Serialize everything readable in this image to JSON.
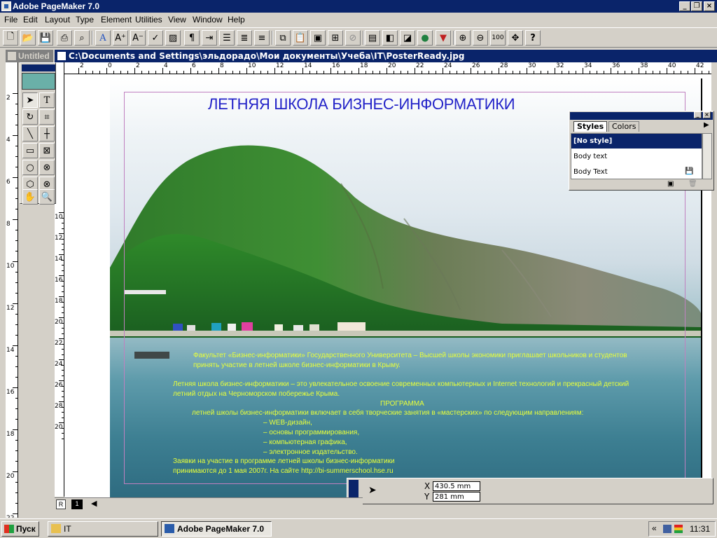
{
  "app": {
    "title": "Adobe PageMaker 7.0"
  },
  "menu": [
    "File",
    "Edit",
    "Layout",
    "Type",
    "Element",
    "Utilities",
    "View",
    "Window",
    "Help"
  ],
  "untitled_tab": "Untitled",
  "document": {
    "path": "C:\\Documents and Settings\\эльдорадо\\Мои документы\\Учеба\\IT\\PosterReady.jpg"
  },
  "hruler_labels": [
    "2",
    "0",
    "2",
    "4",
    "6",
    "8",
    "10",
    "12",
    "14",
    "16",
    "18",
    "20",
    "22",
    "24",
    "26",
    "28",
    "30",
    "32",
    "34",
    "36",
    "38",
    "40",
    "42"
  ],
  "vruler_labels": [
    "2",
    "4",
    "6",
    "8",
    "10",
    "12",
    "14",
    "16",
    "18",
    "20",
    "22"
  ],
  "vruler2_labels": [
    "10",
    "12",
    "14",
    "16",
    "18",
    "20",
    "22",
    "24",
    "26",
    "28",
    "20"
  ],
  "poster": {
    "title": "ЛЕТНЯЯ ШКОЛА БИЗНЕС-ИНФОРМАТИКИ",
    "line1": "Факультет «Бизнес-информатики» Государственного Университета – Высшей школы экономики приглашает школьников и студентов",
    "line2": "принять участие в   летней школе бизнес-информатики в Крыму.",
    "line3": "Летняя школа бизнес-информатики – это увлекательное освоение современных компьютерных и Internet технологий и прекрасный детский",
    "line4": "летний отдых на Черноморском побережье Крыма.",
    "line5": "ПРОГРАММА",
    "line6": "летней школы бизнес-информатики включает в себя творческие занятия в «мастерских» по следующим направлениям:",
    "line7": "– WEB-дизайн,",
    "line8": "– основы программирования,",
    "line9": "– компьютерная графика,",
    "line10": "– электронное издательство.",
    "line11": "Заявки на участие в программе летней школы бизнес-информатики",
    "line12": "принимаются до 1 мая 2007г. На сайте http://bi-summerschool.hse.ru"
  },
  "styles_panel": {
    "tabs": [
      "Styles",
      "Colors"
    ],
    "items": [
      "[No style]",
      "Body text",
      "Body Text"
    ]
  },
  "control_palette": {
    "x_label": "X",
    "y_label": "Y",
    "x_value": "430.5 mm",
    "y_value": "281 mm"
  },
  "page_icons": {
    "master": "R",
    "page": "1"
  },
  "taskbar": {
    "start": "Пуск",
    "tasks": [
      "IT",
      "Adobe PageMaker 7.0"
    ],
    "tray_arrow": "«",
    "clock": "11:31"
  },
  "colors": {
    "title_bar": "#0a246a",
    "poster_title": "#2323c8",
    "poster_text": "#e8ff3a",
    "margin_guide": "#c080c0"
  }
}
